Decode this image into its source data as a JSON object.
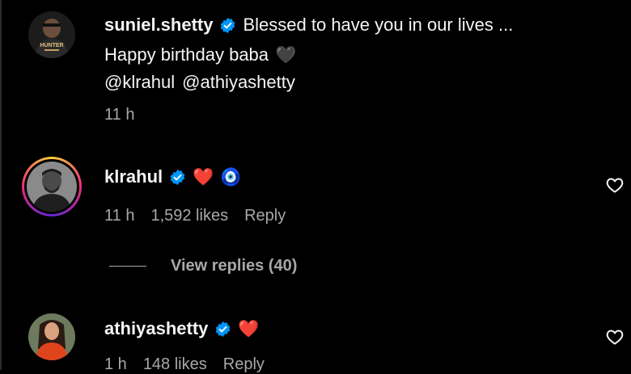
{
  "comments": [
    {
      "username": "suniel.shetty",
      "text_line1": "Blessed to have you in our lives ...",
      "text_line2": "Happy birthday baba",
      "line2_emoji": "🖤",
      "mention1": "@klrahul",
      "mention2": "@athiyashetty",
      "time": "11 h",
      "avatar_text": "HUNTER"
    },
    {
      "username": "klrahul",
      "emoji1": "❤️",
      "emoji2": "🧿",
      "time": "11 h",
      "likes": "1,592 likes",
      "reply_label": "Reply",
      "view_replies": "View replies (40)"
    },
    {
      "username": "athiyashetty",
      "emoji1": "❤️",
      "time": "1 h",
      "likes": "148 likes",
      "reply_label": "Reply"
    }
  ],
  "colors": {
    "background": "#000000",
    "text_primary": "#f5f5f5",
    "text_secondary": "#a8a8a8",
    "verified_blue": "#0095f6",
    "heart_red": "#ff3040"
  },
  "icons": {
    "verified": "verified-badge-icon",
    "like": "heart-outline-icon"
  }
}
